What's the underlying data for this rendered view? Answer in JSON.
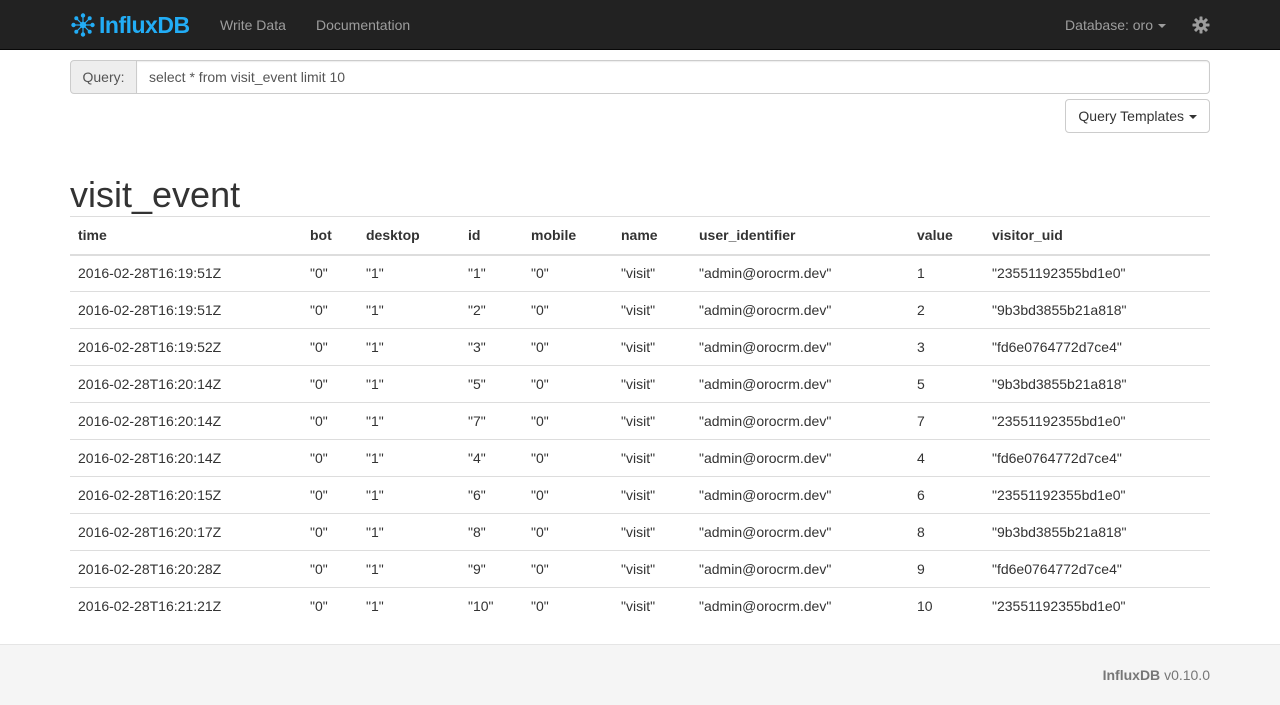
{
  "navbar": {
    "brand": "InfluxDB",
    "logo_icon": "influxdb-logo-icon",
    "links": [
      "Write Data",
      "Documentation"
    ],
    "database_label": "Database: oro",
    "settings_icon": "gear-icon"
  },
  "query": {
    "label": "Query:",
    "value": "select * from visit_event limit 10",
    "templates_label": "Query Templates"
  },
  "results": {
    "series_name": "visit_event",
    "columns": [
      "time",
      "bot",
      "desktop",
      "id",
      "mobile",
      "name",
      "user_identifier",
      "value",
      "visitor_uid"
    ],
    "rows": [
      [
        "2016-02-28T16:19:51Z",
        "\"0\"",
        "\"1\"",
        "\"1\"",
        "\"0\"",
        "\"visit\"",
        "\"admin@orocrm.dev\"",
        "1",
        "\"23551192355bd1e0\""
      ],
      [
        "2016-02-28T16:19:51Z",
        "\"0\"",
        "\"1\"",
        "\"2\"",
        "\"0\"",
        "\"visit\"",
        "\"admin@orocrm.dev\"",
        "2",
        "\"9b3bd3855b21a818\""
      ],
      [
        "2016-02-28T16:19:52Z",
        "\"0\"",
        "\"1\"",
        "\"3\"",
        "\"0\"",
        "\"visit\"",
        "\"admin@orocrm.dev\"",
        "3",
        "\"fd6e0764772d7ce4\""
      ],
      [
        "2016-02-28T16:20:14Z",
        "\"0\"",
        "\"1\"",
        "\"5\"",
        "\"0\"",
        "\"visit\"",
        "\"admin@orocrm.dev\"",
        "5",
        "\"9b3bd3855b21a818\""
      ],
      [
        "2016-02-28T16:20:14Z",
        "\"0\"",
        "\"1\"",
        "\"7\"",
        "\"0\"",
        "\"visit\"",
        "\"admin@orocrm.dev\"",
        "7",
        "\"23551192355bd1e0\""
      ],
      [
        "2016-02-28T16:20:14Z",
        "\"0\"",
        "\"1\"",
        "\"4\"",
        "\"0\"",
        "\"visit\"",
        "\"admin@orocrm.dev\"",
        "4",
        "\"fd6e0764772d7ce4\""
      ],
      [
        "2016-02-28T16:20:15Z",
        "\"0\"",
        "\"1\"",
        "\"6\"",
        "\"0\"",
        "\"visit\"",
        "\"admin@orocrm.dev\"",
        "6",
        "\"23551192355bd1e0\""
      ],
      [
        "2016-02-28T16:20:17Z",
        "\"0\"",
        "\"1\"",
        "\"8\"",
        "\"0\"",
        "\"visit\"",
        "\"admin@orocrm.dev\"",
        "8",
        "\"9b3bd3855b21a818\""
      ],
      [
        "2016-02-28T16:20:28Z",
        "\"0\"",
        "\"1\"",
        "\"9\"",
        "\"0\"",
        "\"visit\"",
        "\"admin@orocrm.dev\"",
        "9",
        "\"fd6e0764772d7ce4\""
      ],
      [
        "2016-02-28T16:21:21Z",
        "\"0\"",
        "\"1\"",
        "\"10\"",
        "\"0\"",
        "\"visit\"",
        "\"admin@orocrm.dev\"",
        "10",
        "\"23551192355bd1e0\""
      ]
    ]
  },
  "footer": {
    "brand": "InfluxDB",
    "version": "v0.10.0"
  },
  "colors": {
    "navbar_bg": "#222222",
    "brand": "#22adf6",
    "nav_text": "#9d9d9d",
    "footer_bg": "#f5f5f5"
  }
}
